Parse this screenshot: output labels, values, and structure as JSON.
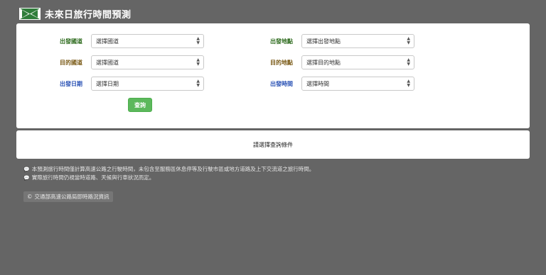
{
  "header": {
    "title": "未來日旅行時間預測",
    "logo_icon": "flag-logo-icon"
  },
  "form": {
    "departure_road": {
      "label": "出發國道",
      "value": "選擇國道"
    },
    "departure_place": {
      "label": "出發地點",
      "value": "選擇出發地點"
    },
    "destination_road": {
      "label": "目的國道",
      "value": "選擇國道"
    },
    "destination_place": {
      "label": "目的地點",
      "value": "選擇目的地點"
    },
    "departure_date": {
      "label": "出發日期",
      "value": "選擇日期"
    },
    "departure_time": {
      "label": "出發時間",
      "value": "選擇時間"
    },
    "query_button": "查詢"
  },
  "result": {
    "message": "請選擇查詢條件"
  },
  "notes": [
    "本預測旅行時間僅計算高速公路之行駛時間，未包含至服務區休息停等及行駛市區或地方道路及上下交流道之旅行時間。",
    "實際旅行時間仍視當時道路、天候與行車狀況而定。"
  ],
  "footer": {
    "copyright": "交通部高速公路局即時路況資訊"
  },
  "colors": {
    "background": "#656565",
    "button": "#5cb85c",
    "label_green": "#2e6b1e",
    "label_brown": "#7a5a16",
    "label_blue": "#2a52b5"
  }
}
